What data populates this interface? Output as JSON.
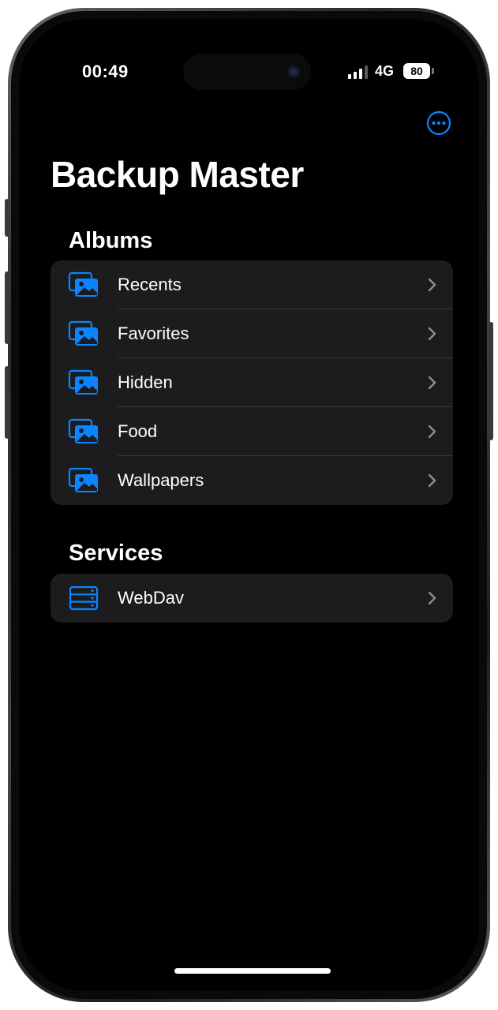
{
  "status_bar": {
    "time": "00:49",
    "network": "4G",
    "battery": "80",
    "signal_bars_active": 3,
    "signal_bars_total": 4
  },
  "nav": {
    "more_icon": "ellipsis-circle-icon",
    "title": "Backup Master"
  },
  "albums": {
    "header": "Albums",
    "items": [
      {
        "label": "Recents",
        "icon": "photo-stack-icon"
      },
      {
        "label": "Favorites",
        "icon": "photo-stack-icon"
      },
      {
        "label": "Hidden",
        "icon": "photo-stack-icon"
      },
      {
        "label": "Food",
        "icon": "photo-stack-icon"
      },
      {
        "label": "Wallpapers",
        "icon": "photo-stack-icon"
      }
    ]
  },
  "services": {
    "header": "Services",
    "items": [
      {
        "label": "WebDav",
        "icon": "server-rack-icon"
      }
    ]
  },
  "colors": {
    "accent": "#0a84ff",
    "background": "#000000",
    "cell": "#1c1c1e",
    "separator": "#38383a",
    "chevron": "#8e8e93"
  }
}
